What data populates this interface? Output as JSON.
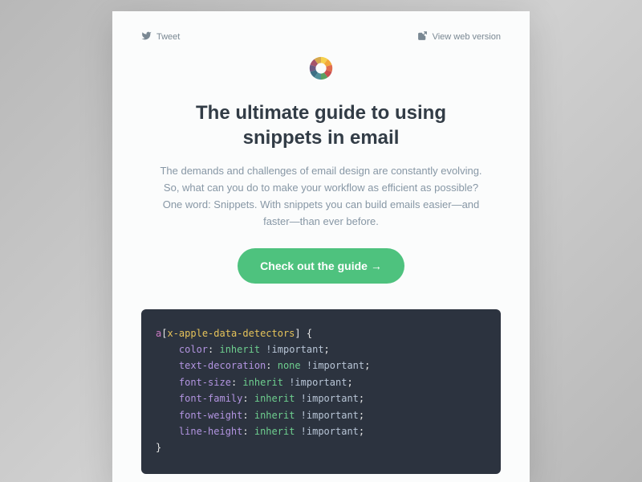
{
  "top": {
    "tweet_label": "Tweet",
    "web_label": "View web version"
  },
  "header": {
    "title": "The ultimate guide to using snippets in email",
    "lede": "The demands and challenges of email design are constantly evolving. So, what can you do to make your workflow as efficient as possible? One word: Snippets. With snippets you can build emails easier—and faster—than ever before."
  },
  "cta": {
    "label": "Check out the guide →"
  },
  "code": {
    "selector_tag": "a",
    "selector_attr": "x-apple-data-detectors",
    "lines": [
      {
        "prop": "color",
        "val": "inherit",
        "imp": "!important"
      },
      {
        "prop": "text-decoration",
        "val": "none",
        "imp": "!important"
      },
      {
        "prop": "font-size",
        "val": "inherit",
        "imp": "!important"
      },
      {
        "prop": "font-family",
        "val": "inherit",
        "imp": "!important"
      },
      {
        "prop": "font-weight",
        "val": "inherit",
        "imp": "!important"
      },
      {
        "prop": "line-height",
        "val": "inherit",
        "imp": "!important"
      }
    ]
  }
}
